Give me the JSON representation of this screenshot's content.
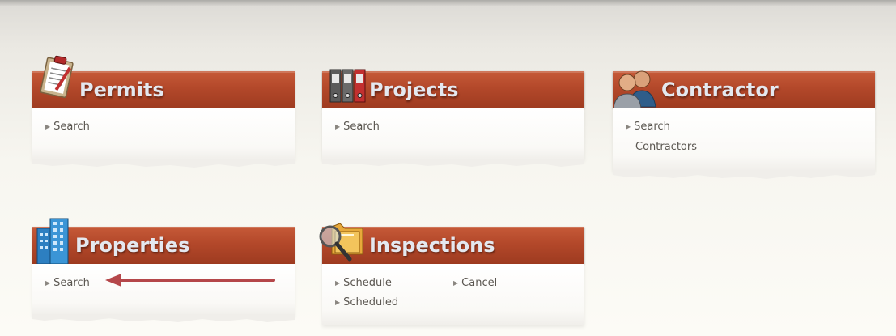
{
  "panels": {
    "permits": {
      "title": "Permits",
      "links": {
        "search": "Search"
      }
    },
    "projects": {
      "title": "Projects",
      "links": {
        "search": "Search"
      }
    },
    "contractor": {
      "title": "Contractor",
      "links": {
        "search": "Search",
        "search_line2": "Contractors"
      }
    },
    "properties": {
      "title": "Properties",
      "links": {
        "search": "Search"
      }
    },
    "inspections": {
      "title": "Inspections",
      "links": {
        "schedule": "Schedule",
        "cancel": "Cancel",
        "scheduled": "Scheduled"
      }
    }
  },
  "icons": {
    "permits": "clipboard-icon",
    "projects": "binders-icon",
    "contractor": "people-icon",
    "properties": "building-icon",
    "inspections": "magnifier-folder-icon",
    "link_bullet": "triangle-right-icon"
  },
  "colors": {
    "header": "#b3482a",
    "header_text": "#e4e8ef",
    "link_text": "#5a5650",
    "annotation_arrow": "#b5474a"
  }
}
